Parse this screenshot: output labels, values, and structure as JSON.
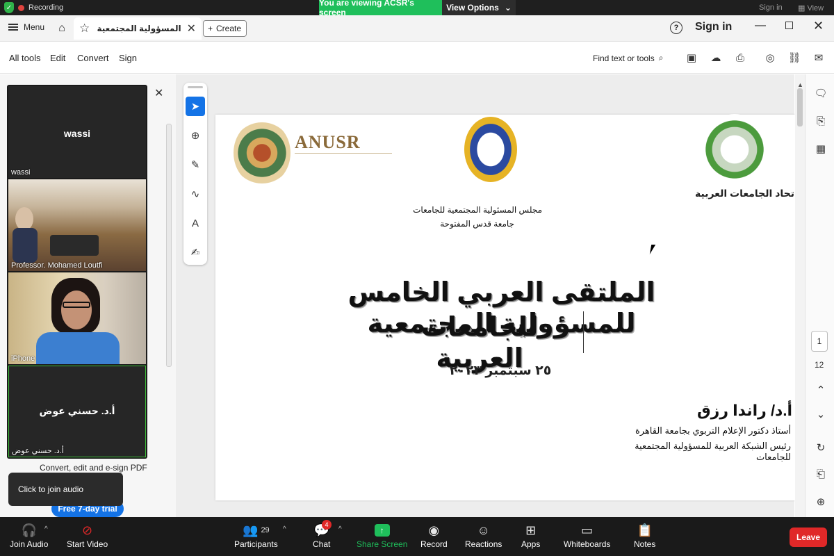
{
  "zoom_top": {
    "recording_label": "Recording",
    "viewing_banner": "You are viewing ACSR's screen",
    "view_options": "View Options",
    "sign_in": "Sign in",
    "view": "View"
  },
  "titlebar": {
    "menu_label": "Menu",
    "tab_title": "المسؤولية المجتمعية للجامعات...",
    "create_label": "Create",
    "sign_in": "Sign in"
  },
  "toolbar": {
    "items": [
      "All tools",
      "Edit",
      "Convert",
      "Sign"
    ],
    "find_placeholder": "Find text or tools"
  },
  "participants": [
    {
      "name": "wassi",
      "center_name": "wassi"
    },
    {
      "name": "Professor. Mohamed Loutfi"
    },
    {
      "name": "iPhone"
    },
    {
      "name": "أ.د. حسني عوض",
      "center_name": "أ.د. حسني عوض"
    }
  ],
  "left_panel": {
    "promo_text": "Convert, edit and e-sign PDF",
    "trial_button": "Free 7-day trial",
    "join_audio_tooltip": "Click to join audio"
  },
  "document": {
    "anusr_logo_text": "ANUSR",
    "aarab_label": "اتحاد الجامعات العربية",
    "council_line": "مجلس المسئولية المجتمعية للجامعات",
    "university_line": "جامعة قدس المفتوحة",
    "title_line1": "الملتقى العربي الخامس للمسؤولية المجتمعية",
    "title_line2": "للجامعات العربية",
    "date": "٢٥ سبتمبر ٢٠٢٣",
    "speaker": "أ.د/ راندا رزق",
    "role1": "أستاذ دكتور  الإعلام التربوي بجامعة القاهرة",
    "role2": "رئيس الشبكة العربية للمسؤولية المجتمعية للجامعات"
  },
  "page_nav": {
    "current": "1",
    "total": "12"
  },
  "zoom_controls": {
    "join_audio": "Join Audio",
    "start_video": "Start Video",
    "participants": "Participants",
    "participants_count": "29",
    "chat": "Chat",
    "chat_badge": "4",
    "share_screen": "Share Screen",
    "record": "Record",
    "reactions": "Reactions",
    "apps": "Apps",
    "whiteboards": "Whiteboards",
    "notes": "Notes",
    "leave": "Leave"
  },
  "colors": {
    "share_green": "#1fbf5b",
    "leave_red": "#e02828",
    "acrobat_blue": "#1473e6"
  }
}
